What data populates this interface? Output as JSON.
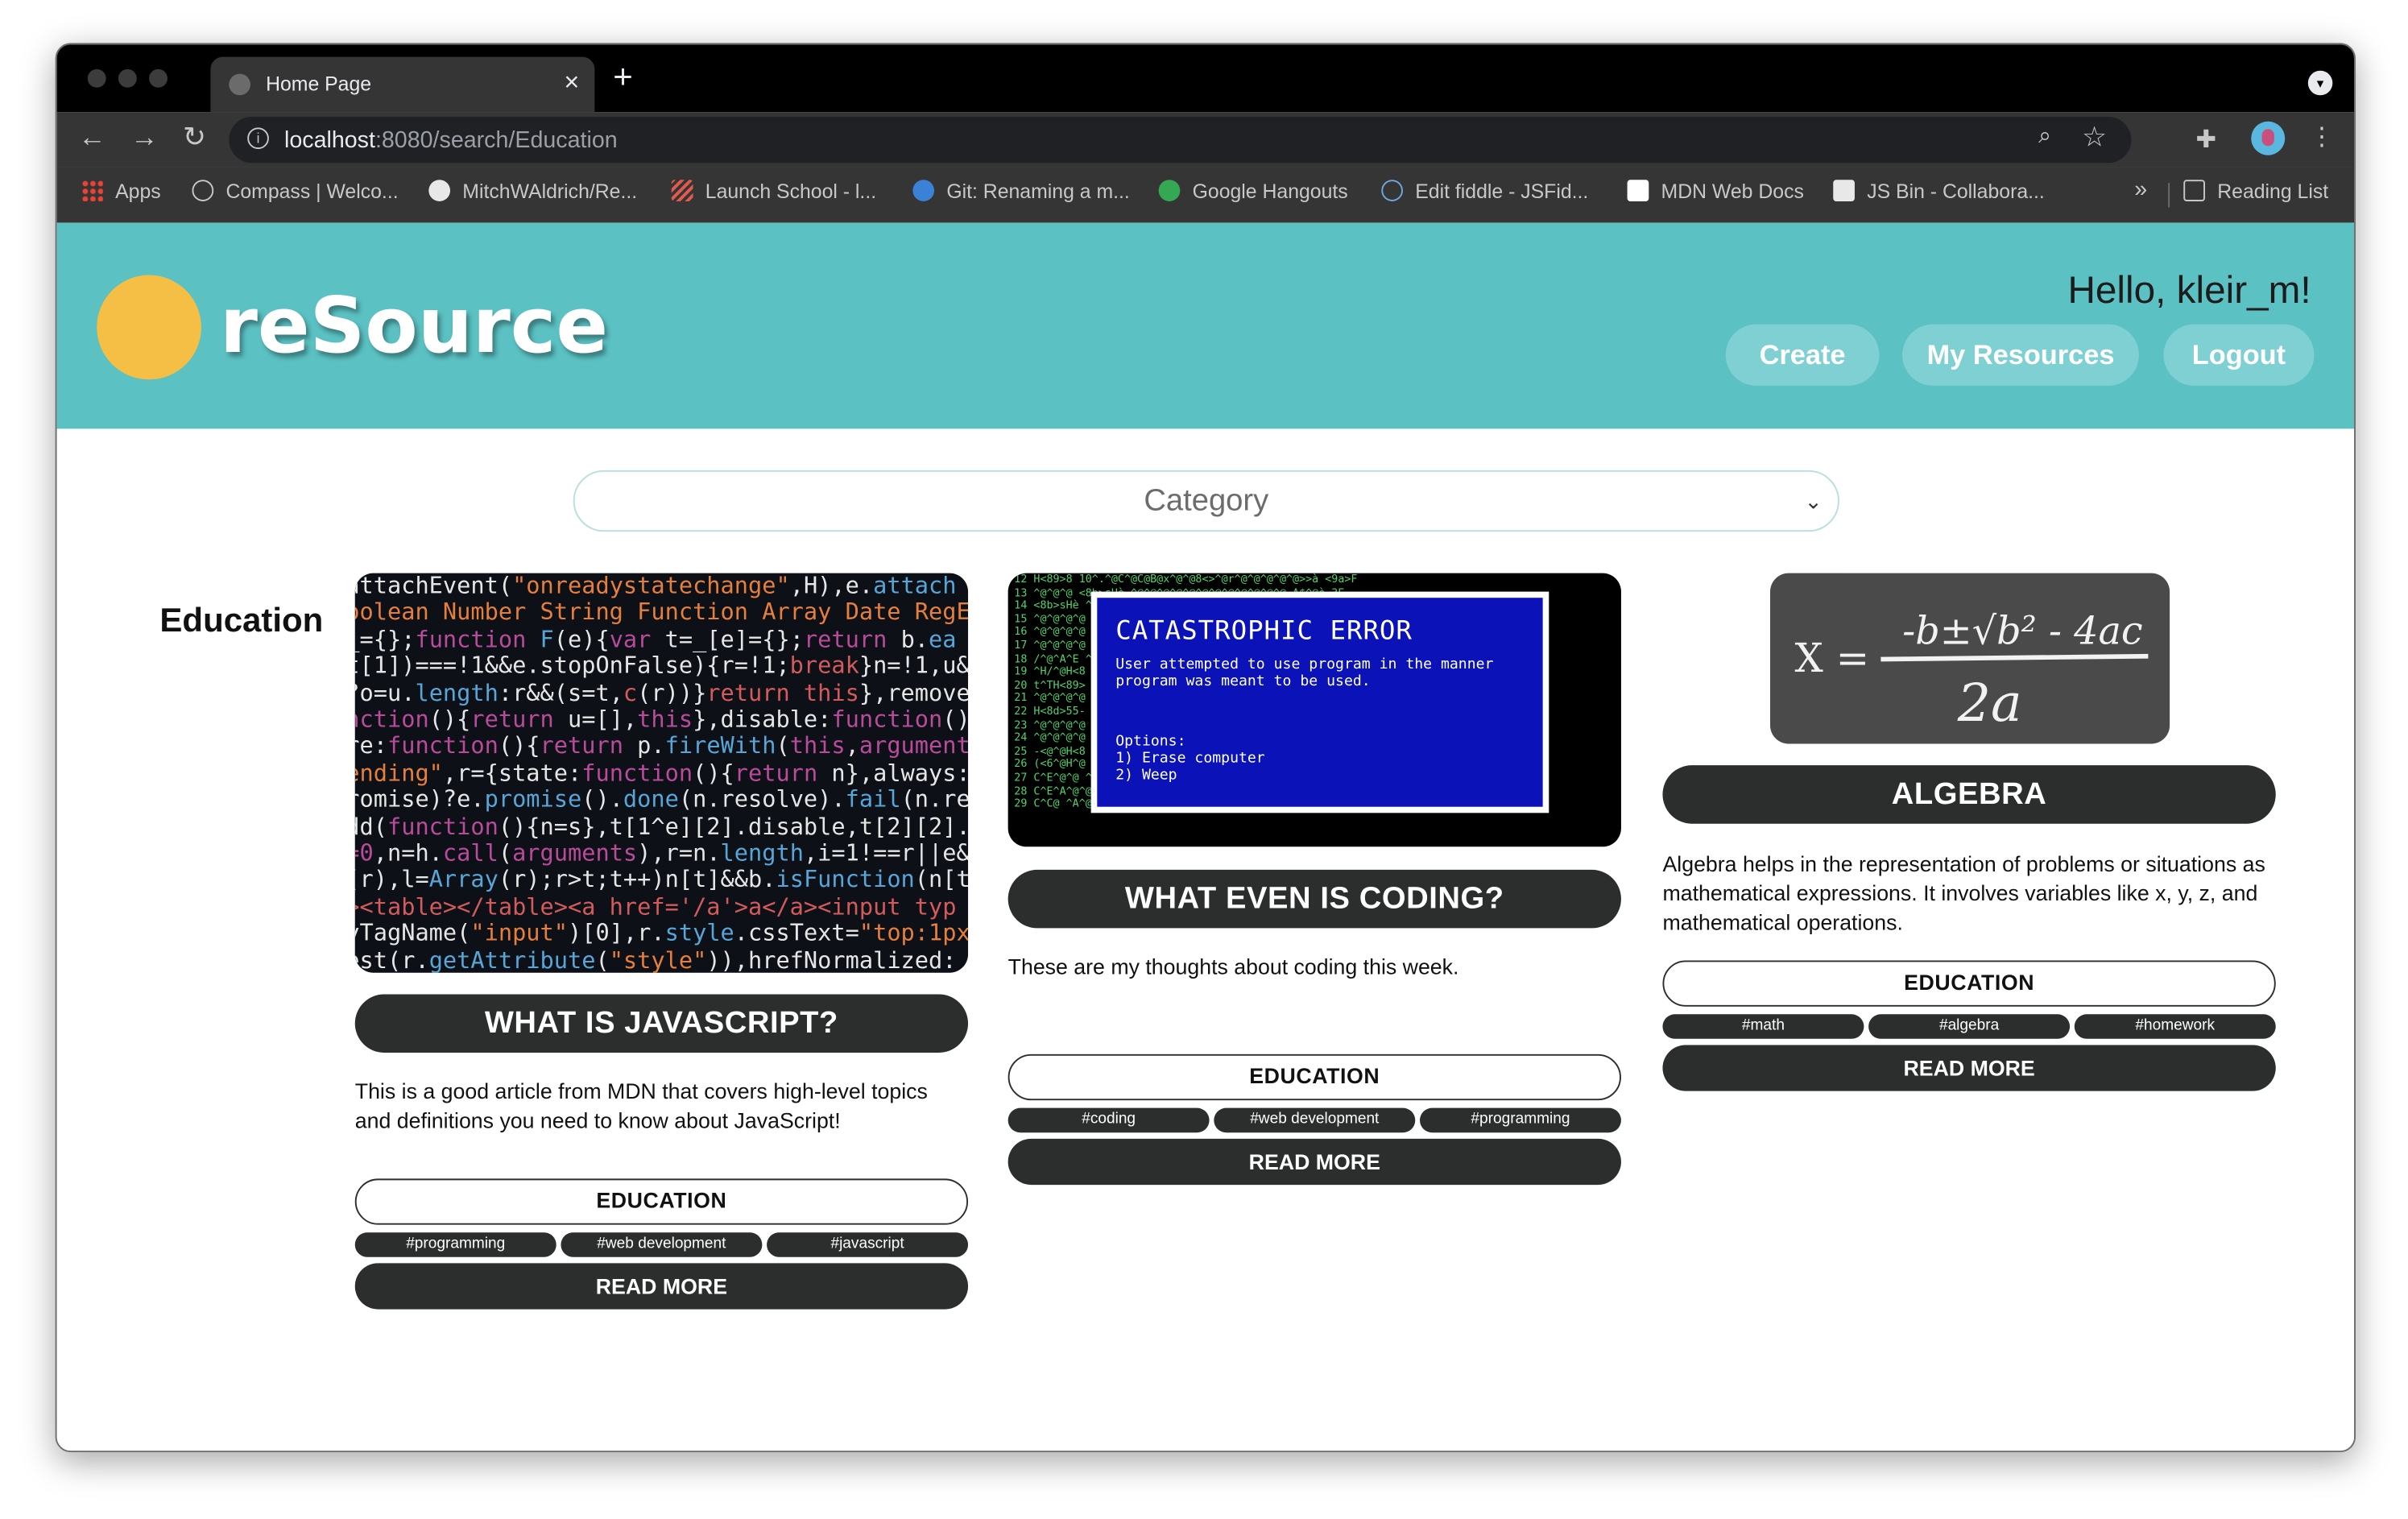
{
  "browser": {
    "tab_title": "Home Page",
    "tab_close": "×",
    "new_tab": "+",
    "url_host": "localhost",
    "url_path": ":8080/search/Education",
    "bookmarks": [
      {
        "label": "Apps",
        "icon": "apps-grid-icon"
      },
      {
        "label": "Compass | Welco...",
        "icon": "compass-icon"
      },
      {
        "label": "MitchWAldrich/Re...",
        "icon": "github-icon"
      },
      {
        "label": "Launch School - l...",
        "icon": "launch-school-icon"
      },
      {
        "label": "Git: Renaming a m...",
        "icon": "git-icon"
      },
      {
        "label": "Google Hangouts",
        "icon": "hangouts-icon"
      },
      {
        "label": "Edit fiddle - JSFid...",
        "icon": "jsfiddle-icon"
      },
      {
        "label": "MDN Web Docs",
        "icon": "mdn-icon"
      },
      {
        "label": "JS Bin - Collabora...",
        "icon": "jsbin-icon"
      }
    ],
    "more": "»",
    "reading_list": "Reading List"
  },
  "header": {
    "logo": "reSource",
    "greeting": "Hello, kleir_m!",
    "buttons": [
      "Create",
      "My Resources",
      "Logout"
    ],
    "colors": {
      "header_bg": "#5bc1c3",
      "logo_dot": "#f4bf44",
      "button_bg": "#7fd0d2"
    }
  },
  "filter": {
    "placeholder": "Category"
  },
  "category_title": "Education",
  "cards": [
    {
      "title": "WHAT IS JAVASCRIPT?",
      "description": "This is a good article from MDN that covers high-level topics and definitions you need to know about JavaScript!",
      "category": "EDUCATION",
      "tags": [
        "#programming",
        "#web development",
        "#javascript"
      ],
      "read_more": "READ MORE"
    },
    {
      "title": "WHAT EVEN IS CODING?",
      "description": "These are my thoughts about coding this week.",
      "category": "EDUCATION",
      "tags": [
        "#coding",
        "#web development",
        "#programming"
      ],
      "read_more": "READ MORE"
    },
    {
      "title": "ALGEBRA",
      "description": "Algebra helps in the representation of problems or situations as mathematical expressions. It involves variables like x, y, z, and mathematical operations.",
      "category": "EDUCATION",
      "tags": [
        "#math",
        "#algebra",
        "#homework"
      ],
      "read_more": "READ MORE"
    }
  ],
  "thumb_error": {
    "heading": "CATASTROPHIC ERROR",
    "body1": "User attempted to use program in the manner",
    "body2": "program was meant to be used.",
    "options": "Options:",
    "opt1": "1) Erase computer",
    "opt2": "2) Weep"
  },
  "thumb_formula": {
    "lhs": "X =",
    "numerator": "-b±√b² - 4ac",
    "denominator": "2a"
  }
}
